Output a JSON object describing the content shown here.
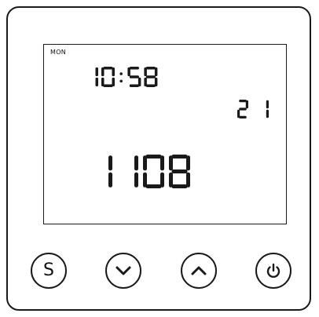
{
  "display": {
    "day": "MON",
    "clock": "10:58",
    "value_small": "21",
    "value_large": "1108"
  },
  "buttons": {
    "set_label": "S",
    "down_icon": "chevron-down-icon",
    "up_icon": "chevron-up-icon",
    "power_icon": "power-icon"
  },
  "colors": {
    "ink": "#1a1a1a",
    "background": "#ffffff"
  }
}
